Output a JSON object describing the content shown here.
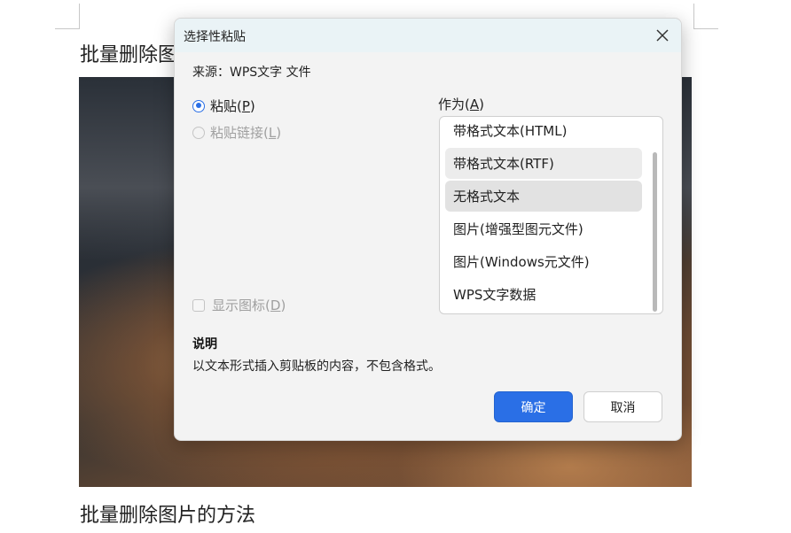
{
  "document": {
    "heading_top": "批量删除图",
    "heading_bottom": "批量删除图片的方法"
  },
  "dialog": {
    "title": "选择性粘贴",
    "source_label": "来源：WPS文字 文件",
    "paste_option": {
      "label": "粘贴",
      "hotkey": "P",
      "checked": true
    },
    "paste_link_option": {
      "label": "粘贴链接",
      "hotkey": "L",
      "disabled": true
    },
    "as_label": {
      "label": "作为",
      "hotkey": "A"
    },
    "as_items": [
      "带格式文本(HTML)",
      "带格式文本(RTF)",
      "无格式文本",
      "图片(增强型图元文件)",
      "图片(Windows元文件)",
      "WPS文字数据"
    ],
    "selected_item": "无格式文本",
    "show_icon_option": {
      "label": "显示图标",
      "hotkey": "D",
      "disabled": true
    },
    "description_title": "说明",
    "description_text": "以文本形式插入剪贴板的内容，不包含格式。",
    "ok_button": "确定",
    "cancel_button": "取消",
    "accent_color": "#2a6fe6"
  }
}
